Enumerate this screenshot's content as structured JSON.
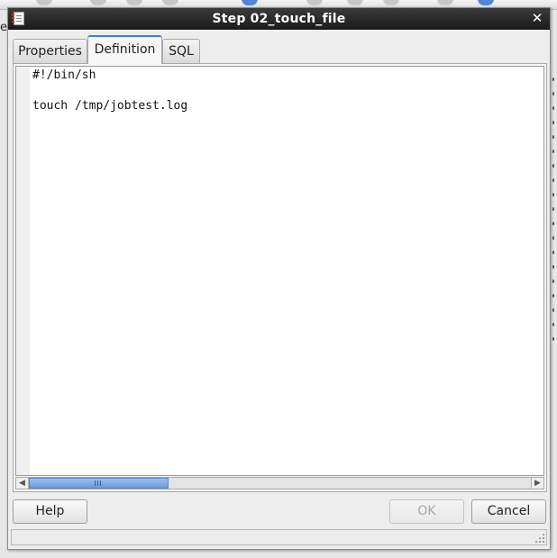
{
  "background": {
    "left_text": "es"
  },
  "dialog": {
    "title": "Step 02_touch_file",
    "close_symbol": "✕"
  },
  "tabs": [
    {
      "label": "Properties",
      "active": false
    },
    {
      "label": "Definition",
      "active": true
    },
    {
      "label": "SQL",
      "active": false
    }
  ],
  "editor": {
    "code": "#!/bin/sh\n\ntouch /tmp/jobtest.log"
  },
  "scrollbar": {
    "left_arrow": "◀",
    "right_arrow": "▶"
  },
  "buttons": {
    "help": "Help",
    "ok": "OK",
    "cancel": "Cancel"
  },
  "colors": {
    "titlebar": "#1a1a1a",
    "active_tab_accent": "#3f7fd1",
    "scroll_thumb": "#6e9ad6"
  },
  "icons": {
    "window_icon": "notepad-icon",
    "close_icon": "close-icon",
    "resize_grip": "resize-grip-icon"
  }
}
